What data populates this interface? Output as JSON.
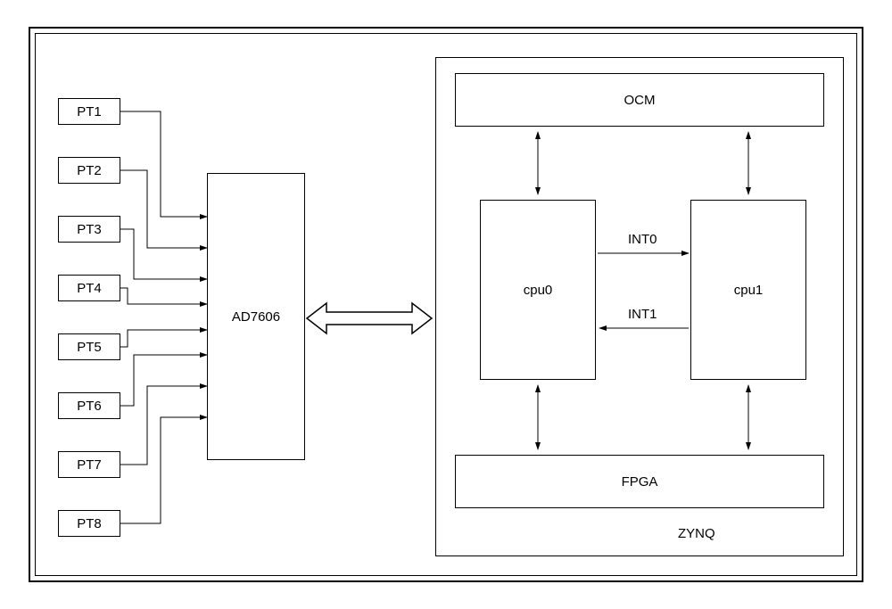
{
  "pt": [
    "PT1",
    "PT2",
    "PT3",
    "PT4",
    "PT5",
    "PT6",
    "PT7",
    "PT8"
  ],
  "adc": "AD7606",
  "zynq": {
    "label": "ZYNQ",
    "ocm": "OCM",
    "fpga": "FPGA",
    "cpu0": "cpu0",
    "cpu1": "cpu1",
    "int0": "INT0",
    "int1": "INT1"
  }
}
